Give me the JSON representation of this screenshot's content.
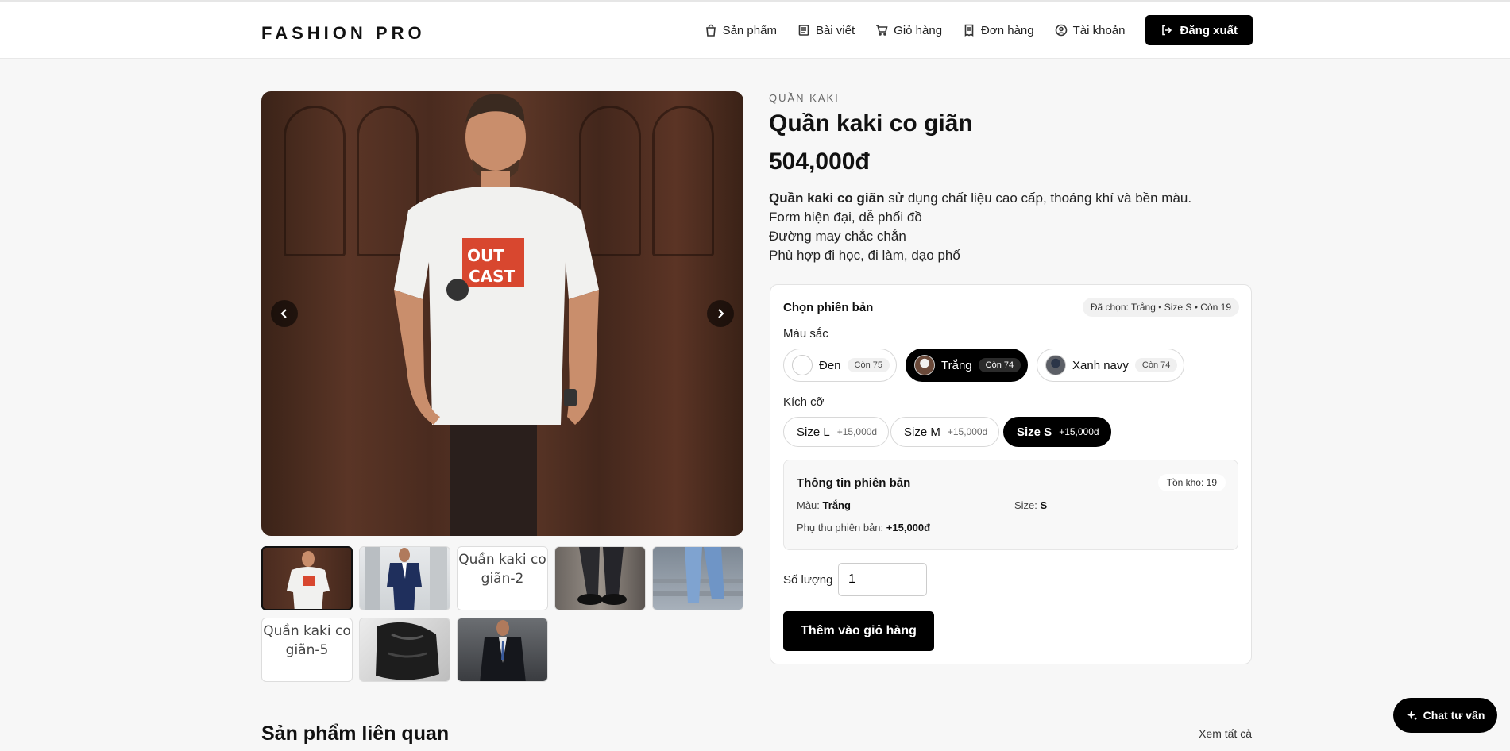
{
  "header": {
    "logo": "FASHION PRO",
    "nav": [
      {
        "label": "Sản phẩm",
        "icon": "bag-icon"
      },
      {
        "label": "Bài viết",
        "icon": "article-icon"
      },
      {
        "label": "Giỏ hàng",
        "icon": "cart-icon"
      },
      {
        "label": "Đơn hàng",
        "icon": "receipt-icon"
      },
      {
        "label": "Tài khoản",
        "icon": "user-icon"
      }
    ],
    "logout_label": "Đăng xuất"
  },
  "gallery": {
    "thumb_alts": [
      "Quần kaki co giãn-2",
      "Quần kaki co giãn-5"
    ]
  },
  "product": {
    "category": "QUẦN KAKI",
    "name": "Quần kaki co giãn",
    "price": "504,000đ",
    "description_bold": "Quần kaki co giãn",
    "description_rest": " sử dụng chất liệu cao cấp, thoáng khí và bền màu.",
    "description_lines": [
      "Form hiện đại, dễ phối đồ",
      "Đường may chắc chắn",
      "Phù hợp đi học, đi làm, dạo phố"
    ]
  },
  "variants": {
    "title": "Chọn phiên bản",
    "selected_summary": "Đã chọn: Trắng • Size S • Còn 19",
    "color_label": "Màu sắc",
    "colors": [
      {
        "name": "Đen",
        "stock": "Còn 75"
      },
      {
        "name": "Trắng",
        "stock": "Còn 74"
      },
      {
        "name": "Xanh navy",
        "stock": "Còn 74"
      }
    ],
    "size_label": "Kích cỡ",
    "sizes": [
      {
        "name": "Size L",
        "extra": "+15,000đ"
      },
      {
        "name": "Size M",
        "extra": "+15,000đ"
      },
      {
        "name": "Size S",
        "extra": "+15,000đ"
      }
    ],
    "info": {
      "title": "Thông tin phiên bản",
      "stock": "Tồn kho: 19",
      "color_key": "Màu:",
      "color_value": "Trắng",
      "size_key": "Size:",
      "size_value": "S",
      "surcharge_key": "Phụ thu phiên bản:",
      "surcharge_value": "+15,000đ"
    },
    "qty_label": "Số lượng",
    "qty_value": "1",
    "add_to_cart": "Thêm vào giỏ hàng"
  },
  "related": {
    "title": "Sản phẩm liên quan",
    "see_all": "Xem tất cả"
  },
  "chat_label": "Chat tư vấn"
}
